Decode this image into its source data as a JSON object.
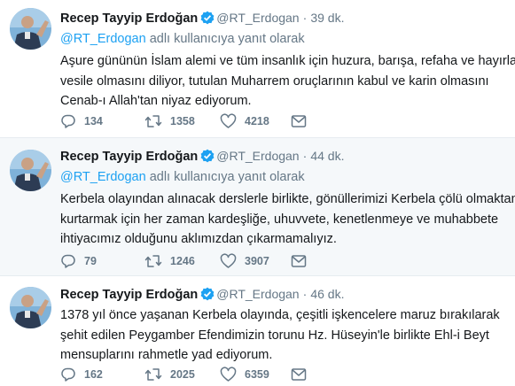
{
  "tweets": [
    {
      "name": "Recep Tayyip Erdoğan",
      "handle": "@RT_Erdogan",
      "dot": "·",
      "time": "39 dk.",
      "reply_link": "@RT_Erdogan",
      "reply_text": " adlı kullanıcıya yanıt olarak",
      "lines": [
        "Aşure gününün İslam alemi ve tüm insanlık için huzura, barışa, refaha ve hayırlara",
        "vesile olmasını diliyor, tutulan Muharrem oruçlarının kabul ve karin olmasını",
        "Cenab-ı Allah'tan niyaz ediyorum."
      ],
      "replies": "134",
      "retweets": "1358",
      "likes": "4218"
    },
    {
      "name": "Recep Tayyip Erdoğan",
      "handle": "@RT_Erdogan",
      "dot": "·",
      "time": "44 dk.",
      "reply_link": "@RT_Erdogan",
      "reply_text": " adlı kullanıcıya yanıt olarak",
      "lines": [
        "Kerbela olayından alınacak derslerle birlikte, gönüllerimizi Kerbela çölü olmaktan",
        "kurtarmak için her zaman kardeşliğe, uhuvvete, kenetlenmeye ve muhabbete",
        "ihtiyacımız olduğunu aklımızdan çıkarmamalıyız."
      ],
      "replies": "79",
      "retweets": "1246",
      "likes": "3907"
    },
    {
      "name": "Recep Tayyip Erdoğan",
      "handle": "@RT_Erdogan",
      "dot": "·",
      "time": "46 dk.",
      "lines": [
        "1378 yıl önce yaşanan Kerbela olayında, çeşitli işkencelere maruz bırakılarak",
        "şehit edilen Peygamber Efendimizin torunu Hz. Hüseyin'le birlikte Ehl-i Beyt",
        "mensuplarını rahmetle yad ediyorum."
      ],
      "replies": "162",
      "retweets": "2025",
      "likes": "6359"
    }
  ],
  "icons": {
    "avatar": "profile-photo",
    "verified": "verified-badge-icon",
    "reply": "reply-icon",
    "retweet": "retweet-icon",
    "like": "heart-icon",
    "dm": "envelope-icon"
  },
  "colors": {
    "verified": "#1da1f2",
    "link": "#1da1f2",
    "muted": "#657786",
    "highlight_bg": "#f5f8fa"
  }
}
